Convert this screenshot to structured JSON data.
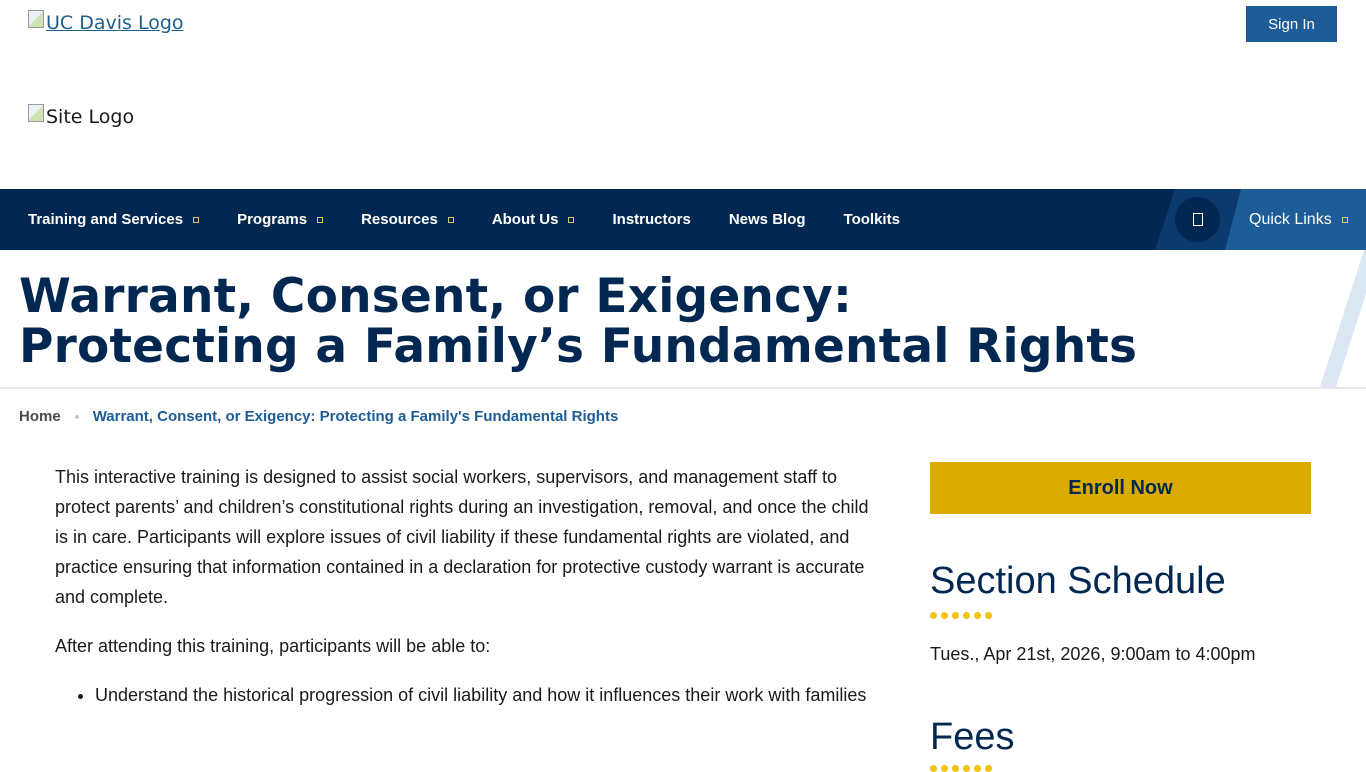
{
  "header": {
    "uc_logo_alt": "UC Davis Logo",
    "site_logo_alt": "Site Logo",
    "sign_in_label": "Sign In"
  },
  "nav": {
    "items": [
      {
        "label": "Training and Services",
        "has_dropdown": true
      },
      {
        "label": "Programs",
        "has_dropdown": true
      },
      {
        "label": "Resources",
        "has_dropdown": true
      },
      {
        "label": "About Us",
        "has_dropdown": true
      },
      {
        "label": "Instructors",
        "has_dropdown": false
      },
      {
        "label": "News Blog",
        "has_dropdown": false
      },
      {
        "label": "Toolkits",
        "has_dropdown": false
      }
    ],
    "search_icon": "search-icon",
    "quick_links_label": "Quick Links"
  },
  "page": {
    "title": "Warrant, Consent, or Exigency: Protecting a Family’s Fundamental Rights"
  },
  "breadcrumb": {
    "home": "Home",
    "current": "Warrant, Consent, or Exigency: Protecting a Family's Fundamental Rights"
  },
  "content": {
    "intro": "This interactive training is designed to assist social workers, supervisors, and management staff to protect parents’ and children’s constitutional rights during an investigation, removal, and once the child is in care. Participants will explore issues of civil liability if these fundamental rights are violated, and practice ensuring that information contained in a declaration for protective custody warrant is accurate and complete.",
    "objectives_lead": "After attending this training, participants will be able to:",
    "objectives": [
      "Understand the historical progression of civil liability and how it influences their work with families"
    ]
  },
  "sidebar": {
    "enroll_label": "Enroll Now",
    "section_schedule_heading": "Section Schedule",
    "schedule_text": "Tues., Apr 21st, 2026, 9:00am to 4:00pm",
    "fees_heading": "Fees"
  },
  "colors": {
    "navy": "#022851",
    "blue": "#1d5c96",
    "gold": "#daaa00",
    "dot_gold": "#f1c40f"
  }
}
